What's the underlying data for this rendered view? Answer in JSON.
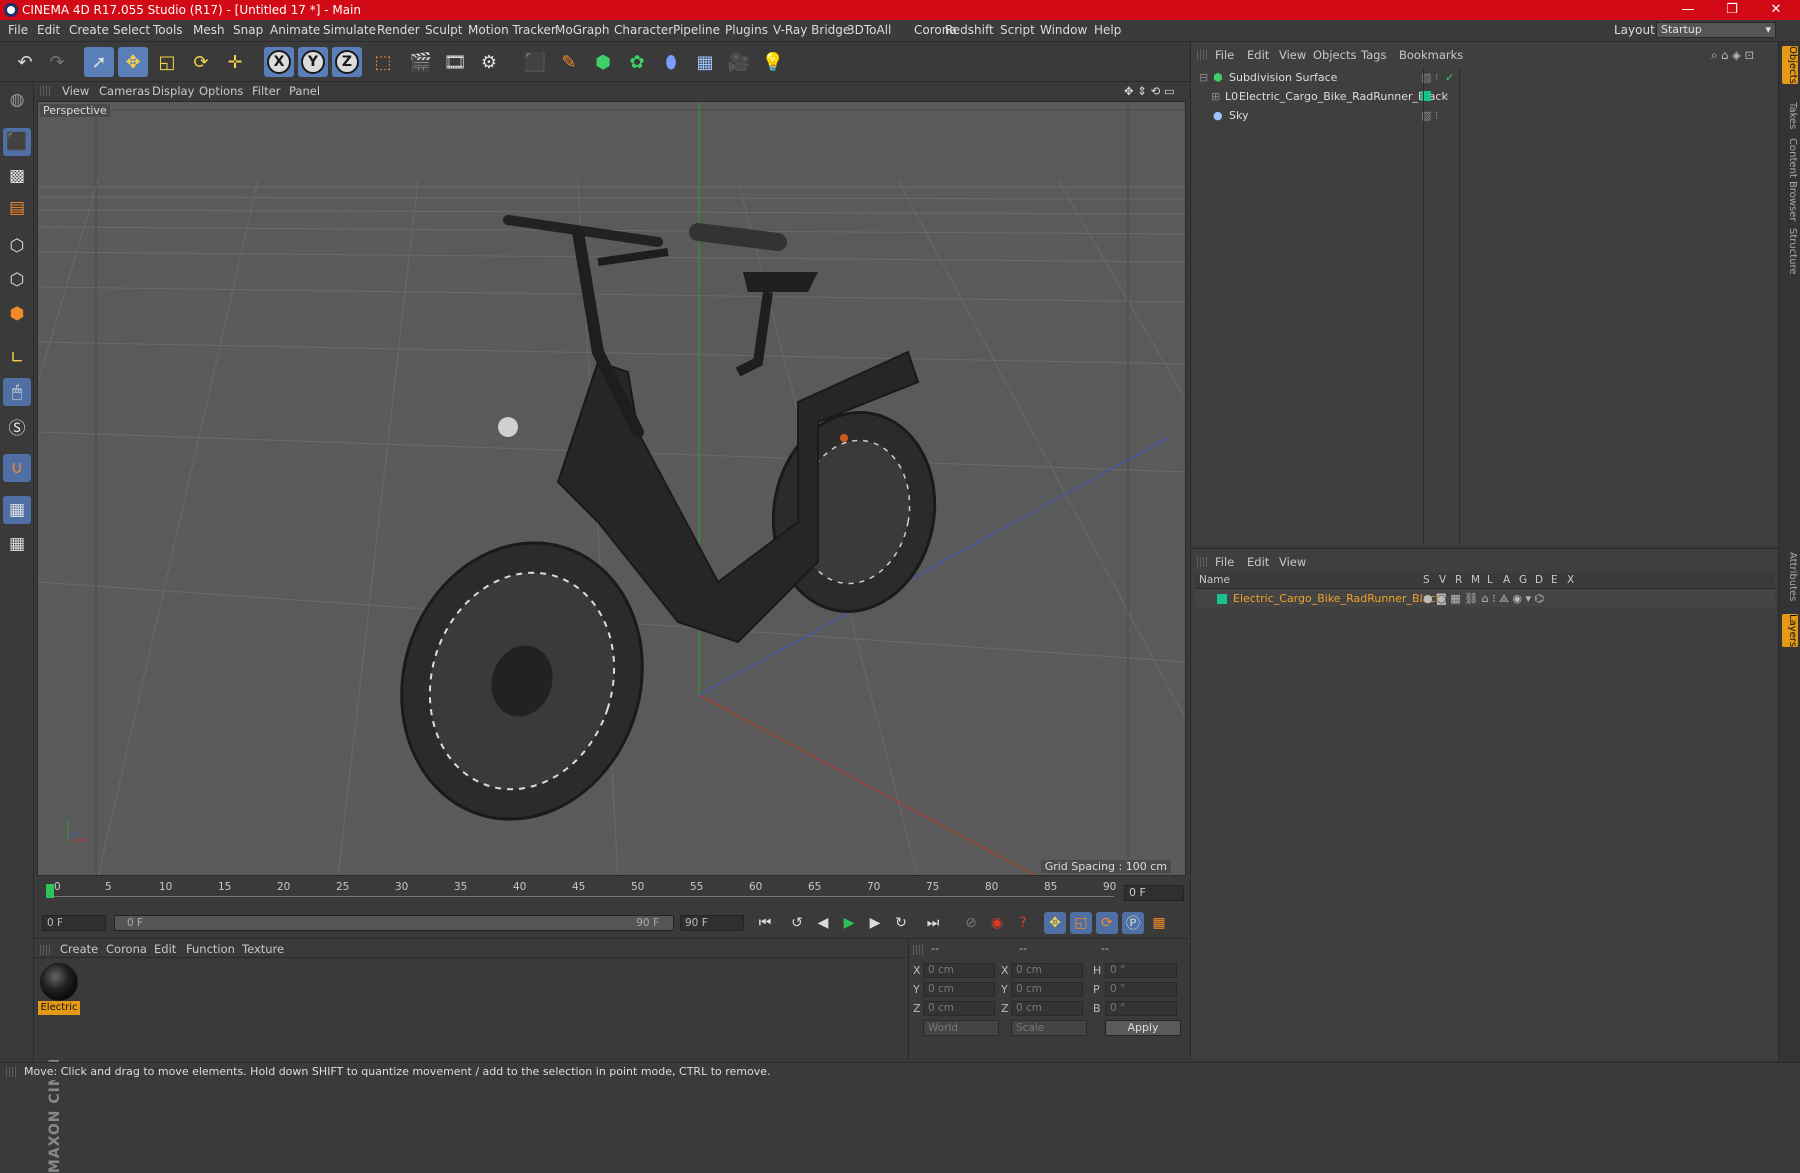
{
  "window": {
    "title": "CINEMA 4D R17.055 Studio (R17) - [Untitled 17 *] - Main",
    "minimize": "—",
    "maximize": "❐",
    "close": "✕"
  },
  "menubar": {
    "items": [
      "File",
      "Edit",
      "Create",
      "Select",
      "Tools",
      "Mesh",
      "Snap",
      "Animate",
      "Simulate",
      "Render",
      "Sculpt",
      "Motion Tracker",
      "MoGraph",
      "Character",
      "Pipeline",
      "Plugins",
      "V-Ray Bridge",
      "3DToAll",
      "Corona",
      "Redshift",
      "Script",
      "Window",
      "Help"
    ],
    "layout_label": "Layout:",
    "layout_value": "Startup"
  },
  "viewport": {
    "menu": [
      "View",
      "Cameras",
      "Display",
      "Options",
      "Filter",
      "Panel"
    ],
    "camera_label": "Perspective",
    "grid_spacing": "Grid Spacing : 100 cm"
  },
  "timeline": {
    "ticks": [
      "0",
      "5",
      "10",
      "15",
      "20",
      "25",
      "30",
      "35",
      "40",
      "45",
      "50",
      "55",
      "60",
      "65",
      "70",
      "75",
      "80",
      "85",
      "90"
    ],
    "current_frame": "0 F",
    "start_field": "0 F",
    "range_start": "0 F",
    "range_end": "90 F",
    "end_field": "90 F"
  },
  "material_manager": {
    "menu": [
      "Create",
      "Corona",
      "Edit",
      "Function",
      "Texture"
    ],
    "materials": [
      {
        "label": "Electric"
      }
    ]
  },
  "coordinates": {
    "headers": [
      "--",
      "--",
      "--"
    ],
    "rows": [
      {
        "a": "X",
        "av": "0 cm",
        "b": "X",
        "bv": "0 cm",
        "c": "H",
        "cv": "0 °"
      },
      {
        "a": "Y",
        "av": "0 cm",
        "b": "Y",
        "bv": "0 cm",
        "c": "P",
        "cv": "0 °"
      },
      {
        "a": "Z",
        "av": "0 cm",
        "b": "Z",
        "bv": "0 cm",
        "c": "B",
        "cv": "0 °"
      }
    ],
    "mode_world": "World",
    "mode_scale": "Scale",
    "apply": "Apply"
  },
  "object_manager": {
    "menu": [
      "File",
      "Edit",
      "View",
      "Objects",
      "Tags",
      "Bookmarks"
    ],
    "objects": [
      {
        "name": "Subdivision Surface",
        "indent": 0
      },
      {
        "name": "Electric_Cargo_Bike_RadRunner_Black",
        "indent": 1
      },
      {
        "name": "Sky",
        "indent": 0
      }
    ]
  },
  "layer_manager": {
    "menu": [
      "File",
      "Edit",
      "View"
    ],
    "columns": [
      "Name",
      "S",
      "V",
      "R",
      "M",
      "L",
      "A",
      "G",
      "D",
      "E",
      "X"
    ],
    "layers": [
      {
        "name": "Electric_Cargo_Bike_RadRunner_Black",
        "color": "#19c28f"
      }
    ]
  },
  "right_tabs": [
    "Objects",
    "Takes",
    "Content Browser",
    "Structure",
    "Attributes",
    "Layers"
  ],
  "status_bar": "Move: Click and drag to move elements. Hold down SHIFT to quantize movement / add to the selection in point mode, CTRL to remove.",
  "colors": {
    "title_bar": "#d20a15",
    "selection_blue": "#5a7fb8",
    "layer_orange": "#f0a22a",
    "viewport_bg": "#5a5a5a"
  }
}
